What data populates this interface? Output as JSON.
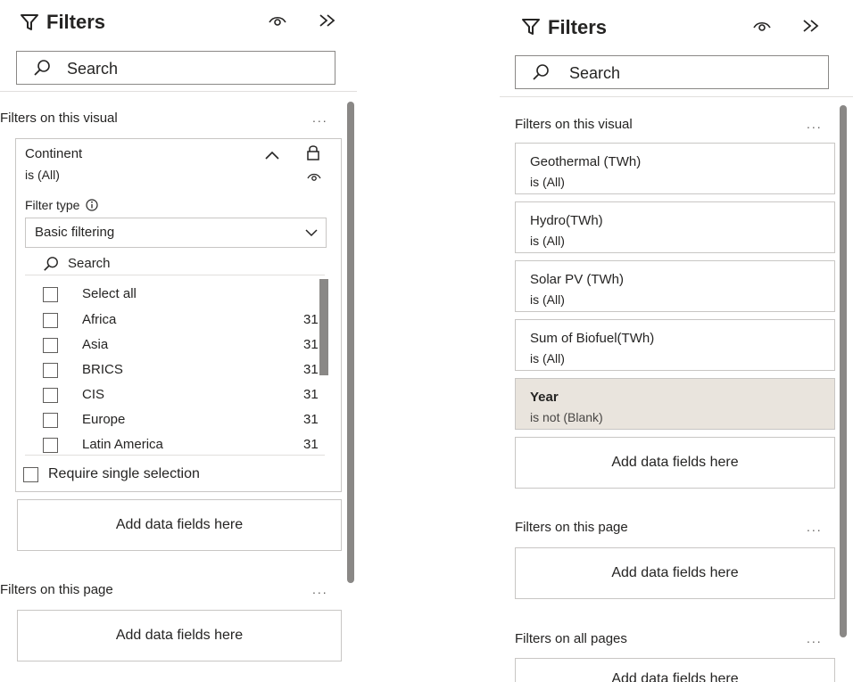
{
  "left_panel": {
    "title": "Filters",
    "search_placeholder": "Search",
    "sections": {
      "visual": "Filters on this visual",
      "page": "Filters on this page",
      "more": "..."
    },
    "continent_card": {
      "field": "Continent",
      "state": "is (All)",
      "filter_type_label": "Filter type",
      "filter_type_value": "Basic filtering",
      "search_label": "Search",
      "select_all": "Select all",
      "options": [
        {
          "label": "Africa",
          "count": "31"
        },
        {
          "label": "Asia",
          "count": "31"
        },
        {
          "label": "BRICS",
          "count": "31"
        },
        {
          "label": "CIS",
          "count": "31"
        },
        {
          "label": "Europe",
          "count": "31"
        },
        {
          "label": "Latin America",
          "count": "31"
        }
      ],
      "require_single": "Require single selection"
    },
    "add_fields_visual": "Add data fields here",
    "add_fields_page": "Add data fields here"
  },
  "right_panel": {
    "title": "Filters",
    "search_placeholder": "Search",
    "sections": {
      "visual": "Filters on this visual",
      "page": "Filters on this page",
      "all_pages": "Filters on all pages",
      "more": "..."
    },
    "cards": [
      {
        "field": "Geothermal (TWh)",
        "state": "is (All)"
      },
      {
        "field": "Hydro(TWh)",
        "state": "is (All)"
      },
      {
        "field": "Solar PV (TWh)",
        "state": "is (All)"
      },
      {
        "field": "Sum of Biofuel(TWh)",
        "state": "is (All)"
      },
      {
        "field": "Year",
        "state": "is not (Blank)"
      }
    ],
    "add_fields_visual": "Add data fields here",
    "add_fields_page": "Add data fields here",
    "add_fields_all": "Add data fields here"
  }
}
